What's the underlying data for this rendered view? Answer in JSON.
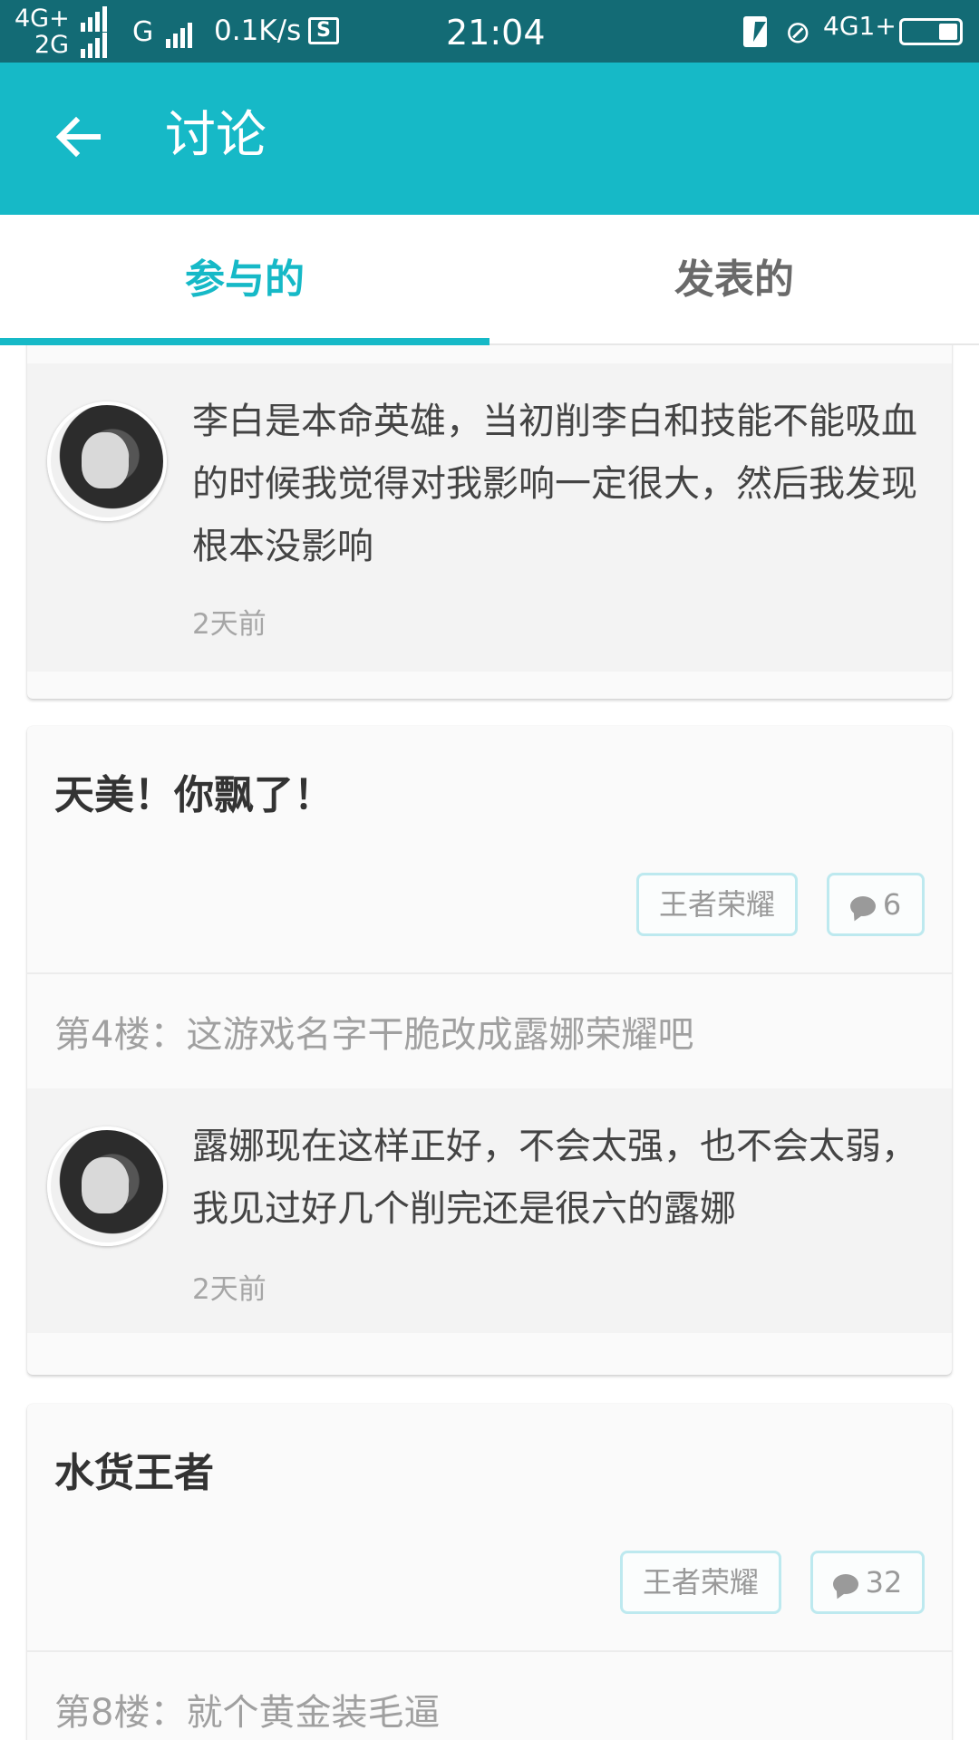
{
  "status_bar": {
    "sig_top": "4G+",
    "sig_bottom": "2G",
    "net": "G",
    "speed": "0.1K/s",
    "sim_icon": "S",
    "time": "21:04",
    "net_right": "4G1+",
    "icons": [
      "charging-icon",
      "mute-icon",
      "battery-icon"
    ]
  },
  "app_bar": {
    "back_icon": "arrow-left-icon",
    "title": "讨论"
  },
  "tabs": [
    {
      "label": "参与的",
      "active": true
    },
    {
      "label": "发表的",
      "active": false
    }
  ],
  "colors": {
    "accent": "#16b9c7",
    "status_bar": "#136b75",
    "tag_border": "#bde9ef"
  },
  "cards": [
    {
      "replies": [
        {
          "text": "李白是本命英雄，当初削李白和技能不能吸血的时候我觉得对我影响一定很大，然后我发现根本没影响",
          "time": "2天前"
        }
      ]
    },
    {
      "title": "天美！你飘了！",
      "tag": "王者荣耀",
      "comments": "6",
      "floor": "第4楼：这游戏名字干脆改成露娜荣耀吧",
      "replies": [
        {
          "text": "露娜现在这样正好，不会太强，也不会太弱，我见过好几个削完还是很六的露娜",
          "time": "2天前"
        }
      ]
    },
    {
      "title": "水货王者",
      "tag": "王者荣耀",
      "comments": "32",
      "floor": "第8楼：就个黄金装毛逼"
    }
  ]
}
